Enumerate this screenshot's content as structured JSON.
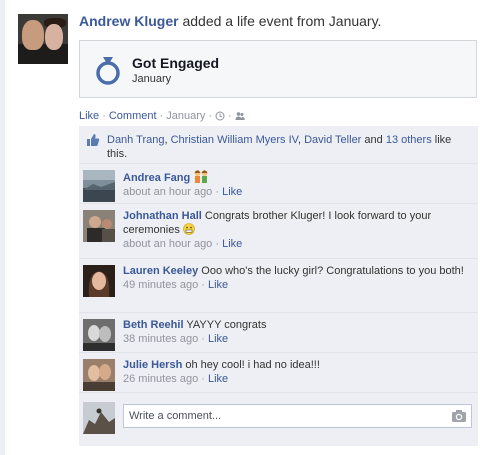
{
  "story": {
    "actor": "Andrew Kluger",
    "headline_rest": " added a life event from January.",
    "event_title": "Got Engaged",
    "event_subtitle": "January",
    "event_icon": "ring-icon"
  },
  "actions": {
    "like": "Like",
    "sep1": " · ",
    "comment": "Comment",
    "sep2": " · ",
    "date": "January",
    "sep3": " · ",
    "sep4": " · "
  },
  "likes": {
    "names": [
      "Danh Trang",
      "Christian William Myers IV",
      "David Teller"
    ],
    "comma": ", ",
    "and": " and ",
    "others": "13 others",
    "suffix": " like this."
  },
  "comments": [
    {
      "author": "Andrea Fang",
      "text": "",
      "time": "about an hour ago",
      "like": "Like",
      "emoji": "couple-emoji"
    },
    {
      "author": "Johnathan Hall",
      "text": "Congrats brother Kluger! I look forward to your ceremonies",
      "time": "about an hour ago",
      "like": "Like",
      "emoji": "grimace-emoji"
    },
    {
      "author": "Lauren Keeley",
      "text": "Ooo who's the lucky girl? Congratulations to you both!",
      "time": "49 minutes ago",
      "like": "Like"
    },
    {
      "author": "Beth Reehil",
      "text": "YAYYY congrats",
      "time": "38 minutes ago",
      "like": "Like"
    },
    {
      "author": "Julie Hersh",
      "text": "oh hey cool! i had no idea!!!",
      "time": "26 minutes ago",
      "like": "Like"
    }
  ],
  "meta_sep": " · ",
  "composer": {
    "placeholder": "Write a comment...",
    "camera_icon": "camera-icon"
  },
  "colors": {
    "link": "#3b5998",
    "ufi_bg": "#edeff4",
    "meta": "#90949c"
  }
}
